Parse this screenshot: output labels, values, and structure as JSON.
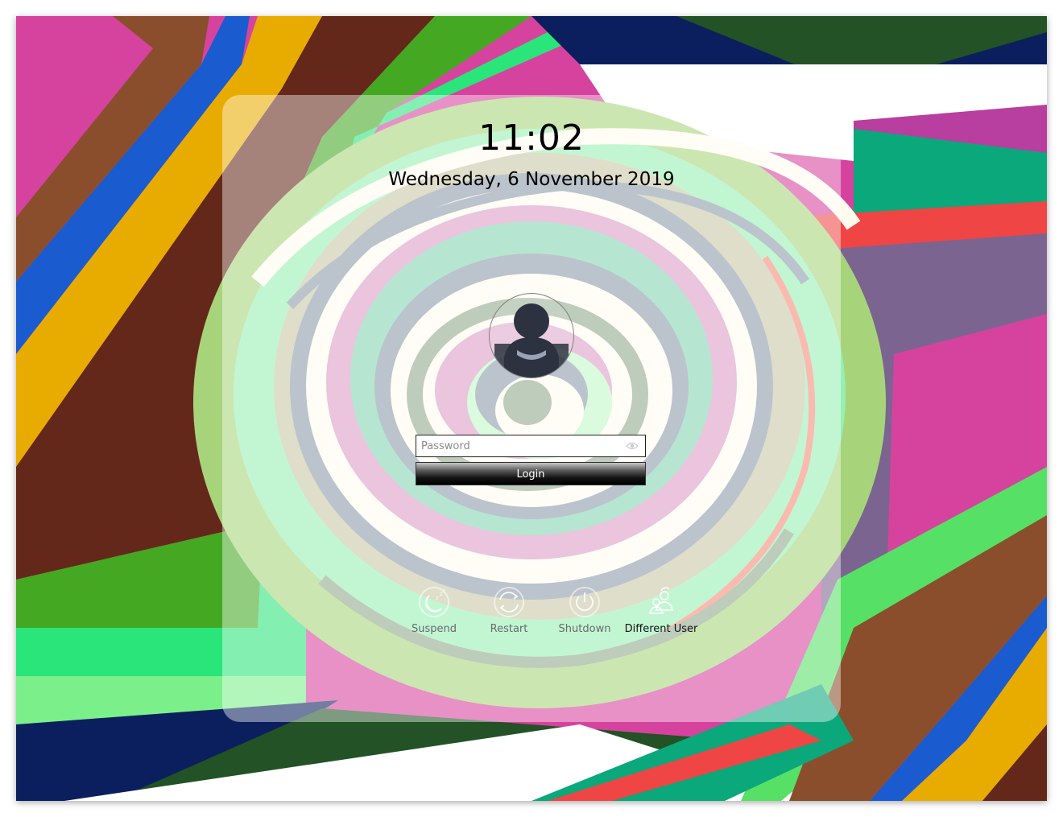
{
  "clock": {
    "time": "11:02",
    "date": "Wednesday, 6 November 2019"
  },
  "user": {
    "avatar_icon": "user-avatar-icon",
    "name": ""
  },
  "login_form": {
    "password_placeholder": "Password",
    "reveal_icon": "eye-icon",
    "login_label": "Login"
  },
  "actions": [
    {
      "label": "Suspend",
      "icon": "suspend-icon"
    },
    {
      "label": "Restart",
      "icon": "restart-icon"
    },
    {
      "label": "Shutdown",
      "icon": "shutdown-icon"
    },
    {
      "label": "Different User",
      "icon": "different-user-icon"
    }
  ],
  "colors": {
    "panel": "#ffffff",
    "login_button": "#000000",
    "wallpaper_magenta": "#d63f9b",
    "wallpaper_brown": "#8b4e2c",
    "wallpaper_yellow": "#e8ac00",
    "wallpaper_green": "#40aa1c",
    "wallpaper_blue": "#2059d0",
    "wallpaper_navy": "#0b1f5e"
  }
}
